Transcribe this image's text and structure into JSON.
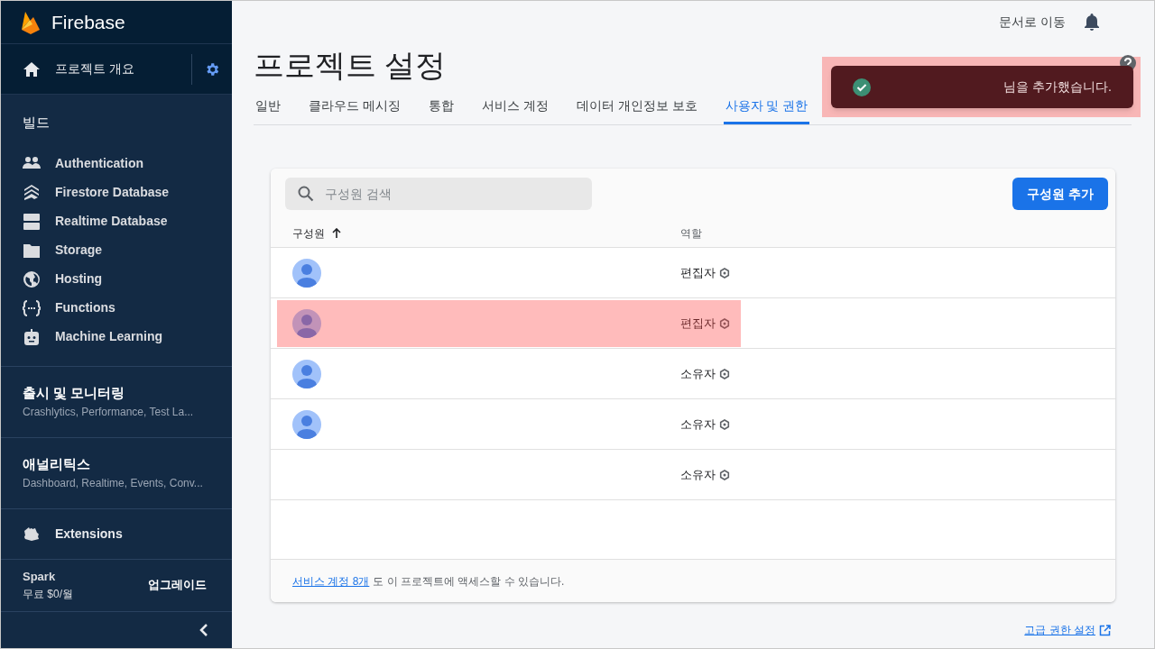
{
  "brand": "Firebase",
  "overview": {
    "label": "프로젝트 개요"
  },
  "build": {
    "title": "빌드",
    "items": [
      {
        "label": "Authentication",
        "kind": "people"
      },
      {
        "label": "Firestore Database",
        "kind": "firestore"
      },
      {
        "label": "Realtime Database",
        "kind": "server"
      },
      {
        "label": "Storage",
        "kind": "image"
      },
      {
        "label": "Hosting",
        "kind": "globe"
      },
      {
        "label": "Functions",
        "kind": "functions"
      },
      {
        "label": "Machine Learning",
        "kind": "robot"
      }
    ]
  },
  "sections": [
    {
      "title": "출시 및 모니터링",
      "subtitle": "Crashlytics, Performance, Test La..."
    },
    {
      "title": "애널리틱스",
      "subtitle": "Dashboard, Realtime, Events, Conv..."
    }
  ],
  "extensions": {
    "label": "Extensions"
  },
  "plan": {
    "name": "Spark",
    "price": "무료 $0/월",
    "upgrade": "업그레이드"
  },
  "topbar": {
    "docs": "문서로 이동"
  },
  "page_title": "프로젝트 설정",
  "tabs": [
    {
      "label": "일반",
      "selected": false
    },
    {
      "label": "클라우드 메시징",
      "selected": false
    },
    {
      "label": "통합",
      "selected": false
    },
    {
      "label": "서비스 계정",
      "selected": false
    },
    {
      "label": "데이터 개인정보 보호",
      "selected": false
    },
    {
      "label": "사용자 및 권한",
      "selected": true
    }
  ],
  "toast": {
    "message": "님을 추가했습니다.",
    "highlighted": true
  },
  "members": {
    "search": {
      "placeholder": "구성원 검색"
    },
    "add_button": "구성원 추가",
    "columns": [
      "구성원",
      "역할"
    ],
    "rows": [
      {
        "avatar": true,
        "role": "편집자",
        "highlighted": false
      },
      {
        "avatar": true,
        "role": "편집자",
        "highlighted": true
      },
      {
        "avatar": true,
        "role": "소유자",
        "highlighted": false
      },
      {
        "avatar": true,
        "role": "소유자",
        "highlighted": false
      },
      {
        "avatar": false,
        "role": "소유자",
        "highlighted": false
      }
    ],
    "footer": {
      "link": "서비스 계정 8개",
      "text": "도 이 프로젝트에 액세스할 수 있습니다."
    }
  },
  "advanced_link": "고급 권한 설정"
}
